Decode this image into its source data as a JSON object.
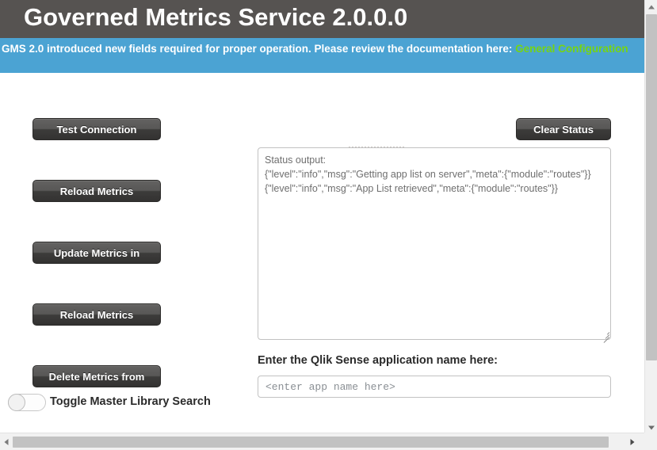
{
  "header": {
    "title": "Governed Metrics Service 2.0.0.0"
  },
  "banner": {
    "text_before_link": "GMS 2.0 introduced new fields required for proper operation. Please review the documentation here: ",
    "link_label": "General Configuration",
    "background_color": "#4ba3d3",
    "link_color": "#76d413"
  },
  "actions": {
    "test_connection_label": "Test Connection",
    "reload_metrics_1_label": "Reload Metrics",
    "update_metrics_label": "Update Metrics in",
    "reload_metrics_2_label": "Reload Metrics",
    "delete_metrics_label": "Delete Metrics from",
    "clear_status_label": "Clear Status"
  },
  "toggle": {
    "label": "Toggle Master Library Search",
    "state": "off"
  },
  "status": {
    "value": "Status output:\n{\"level\":\"info\",\"msg\":\"Getting app list on server\",\"meta\":{\"module\":\"routes\"}}\n{\"level\":\"info\",\"msg\":\"App List retrieved\",\"meta\":{\"module\":\"routes\"}}"
  },
  "app_name": {
    "label": "Enter the Qlik Sense application name here:",
    "value": "",
    "placeholder": "<enter app name here>"
  },
  "scrollbars": {
    "vertical_up_icon": "chevron-up-icon",
    "vertical_down_icon": "chevron-down-icon",
    "horizontal_left_icon": "chevron-left-icon",
    "horizontal_right_icon": "chevron-right-icon"
  }
}
